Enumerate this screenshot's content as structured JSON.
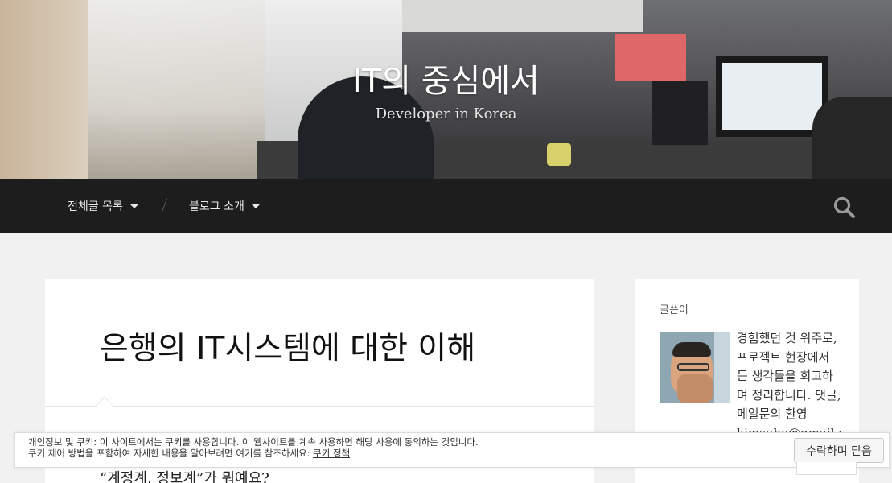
{
  "header": {
    "site_title": "IT의 중심에서",
    "site_description": "Developer in Korea"
  },
  "nav": {
    "items": [
      {
        "label": "전체글 목록"
      },
      {
        "label": "블로그 소개"
      }
    ],
    "search_icon": "search-icon"
  },
  "post": {
    "title": "은행의 IT시스템에 대한 이해",
    "quote": "“계정계, 정보계”가 뭐예요?"
  },
  "sidebar": {
    "widget_title": "글쓴이",
    "about_text": "경험했던 것 위주로, 프로젝트 현장에서 든 생각들을 회고하며 정리합니다. 댓글, 메일문의 환영 kimsuho@gmail.com"
  },
  "cookie_banner": {
    "line1": "개인정보 및 쿠키: 이 사이트에서는 쿠키를 사용합니다. 이 웹사이트를 계속 사용하면 해당 사용에 동의하는 것입니다.",
    "line2_prefix": "쿠키 제어 방법을 포함하여 자세한 내용을 알아보려면 여기를 참조하세요: ",
    "link_label": "쿠키 정책",
    "accept_label": "수락하며 닫음"
  },
  "colors": {
    "navbar_bg": "#1d1d1d",
    "page_bg": "#f1f1f1",
    "card_bg": "#ffffff"
  }
}
